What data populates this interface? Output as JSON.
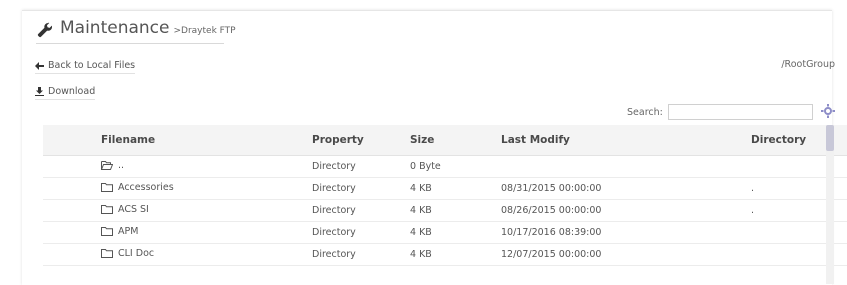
{
  "header": {
    "title": "Maintenance",
    "subtitle": ">Draytek FTP",
    "icon": "wrench-icon"
  },
  "toolbar": {
    "back_label": "Back to Local Files",
    "download_label": "Download",
    "root_group": "/RootGroup"
  },
  "search": {
    "label": "Search:",
    "value": "",
    "placeholder": ""
  },
  "table": {
    "columns": [
      "Filename",
      "Property",
      "Size",
      "Last Modify",
      "Directory"
    ],
    "rows": [
      {
        "icon": "folder-open-icon",
        "filename": "..",
        "property": "Directory",
        "size": "0 Byte",
        "last_modify": "",
        "directory": ""
      },
      {
        "icon": "folder-icon",
        "filename": "Accessories",
        "property": "Directory",
        "size": "4 KB",
        "last_modify": "08/31/2015 00:00:00",
        "directory": "."
      },
      {
        "icon": "folder-icon",
        "filename": "ACS SI",
        "property": "Directory",
        "size": "4 KB",
        "last_modify": "08/26/2015 00:00:00",
        "directory": "."
      },
      {
        "icon": "folder-icon",
        "filename": "APM",
        "property": "Directory",
        "size": "4 KB",
        "last_modify": "10/17/2016 08:39:00",
        "directory": ""
      },
      {
        "icon": "folder-icon",
        "filename": "CLI Doc",
        "property": "Directory",
        "size": "4 KB",
        "last_modify": "12/07/2015 00:00:00",
        "directory": ""
      }
    ]
  },
  "colors": {
    "header_bg": "#f4f4f4",
    "row_border": "#ececec",
    "scroll_thumb": "#c8c8d8",
    "text": "#555555"
  }
}
